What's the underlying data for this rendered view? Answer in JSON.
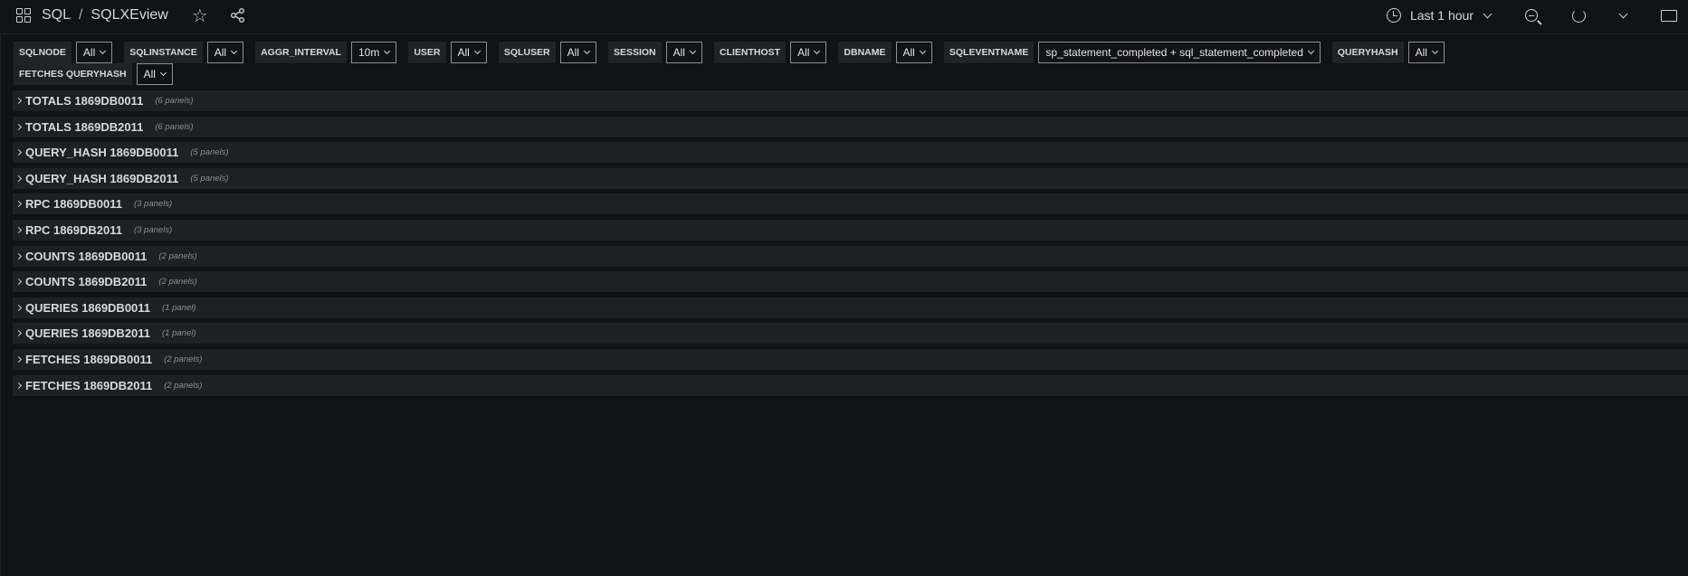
{
  "header": {
    "breadcrumb": [
      "SQL",
      "SQLXEview"
    ],
    "separator": "/",
    "time_range": "Last 1 hour"
  },
  "variables": [
    {
      "label": "SQLNODE",
      "value": "All"
    },
    {
      "label": "SQLINSTANCE",
      "value": "All"
    },
    {
      "label": "AGGR_INTERVAL",
      "value": "10m"
    },
    {
      "label": "USER",
      "value": "All"
    },
    {
      "label": "SQLUSER",
      "value": "All"
    },
    {
      "label": "SESSION",
      "value": "All"
    },
    {
      "label": "CLIENTHOST",
      "value": "All"
    },
    {
      "label": "DBNAME",
      "value": "All"
    },
    {
      "label": "SQLEVENTNAME",
      "value": "sp_statement_completed + sql_statement_completed"
    },
    {
      "label": "QUERYHASH",
      "value": "All"
    },
    {
      "label": "FETCHES QUERYHASH",
      "value": "All"
    }
  ],
  "rows": [
    {
      "title": "TOTALS 1869DB0011",
      "count": "(6 panels)"
    },
    {
      "title": "TOTALS 1869DB2011",
      "count": "(6 panels)"
    },
    {
      "title": "QUERY_HASH 1869DB0011",
      "count": "(5 panels)"
    },
    {
      "title": "QUERY_HASH 1869DB2011",
      "count": "(5 panels)"
    },
    {
      "title": "RPC 1869DB0011",
      "count": "(3 panels)"
    },
    {
      "title": "RPC 1869DB2011",
      "count": "(3 panels)"
    },
    {
      "title": "COUNTS 1869DB0011",
      "count": "(2 panels)"
    },
    {
      "title": "COUNTS 1869DB2011",
      "count": "(2 panels)"
    },
    {
      "title": "QUERIES 1869DB0011",
      "count": "(1 panel)"
    },
    {
      "title": "QUERIES 1869DB2011",
      "count": "(1 panel)"
    },
    {
      "title": "FETCHES 1869DB0011",
      "count": "(2 panels)"
    },
    {
      "title": "FETCHES 1869DB2011",
      "count": "(2 panels)"
    }
  ]
}
